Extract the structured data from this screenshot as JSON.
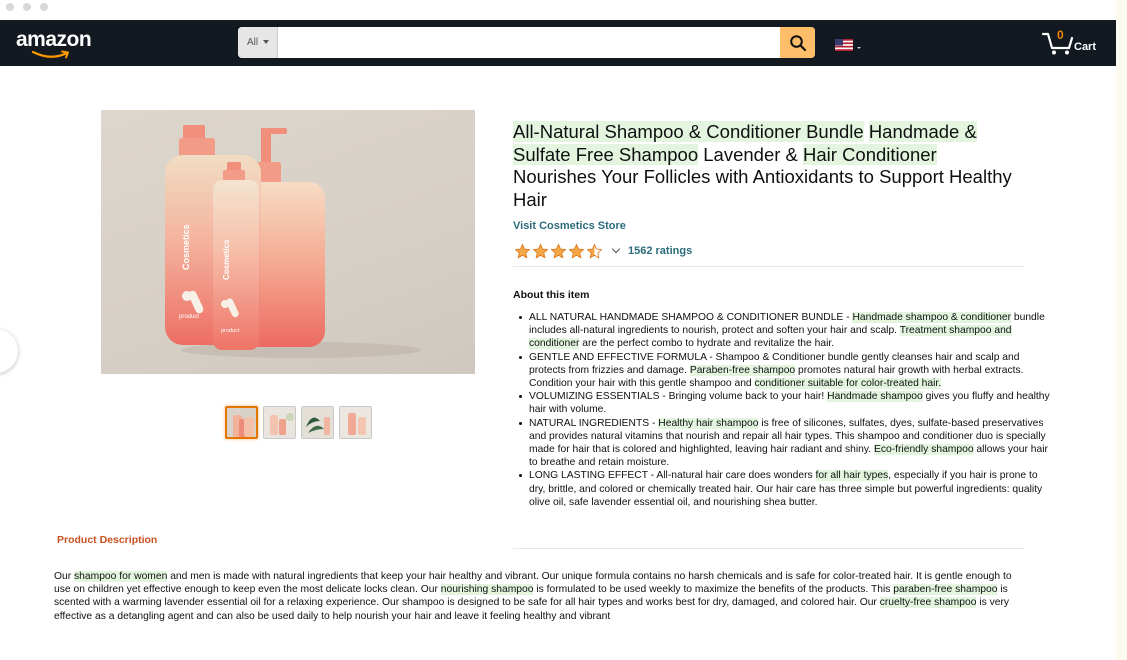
{
  "header": {
    "logo_text": "amazon",
    "search_category": "All",
    "search_placeholder": "",
    "cart_count": "0",
    "cart_label": "Cart"
  },
  "product": {
    "title_parts": [
      {
        "text": "All-Natural Shampoo & Conditioner Bundle",
        "highlight": true
      },
      {
        "text": " ",
        "highlight": false
      },
      {
        "text": "Handmade & Sulfate Free Shampoo",
        "highlight": true
      },
      {
        "text": " Lavender & ",
        "highlight": false
      },
      {
        "text": "Hair Conditioner",
        "highlight": true
      },
      {
        "text": " Nourishes Your Follicles with Antioxidants to Support Healthy Hair",
        "highlight": false
      }
    ],
    "store_link": "Visit Cosmetics Store",
    "rating_value": 4.5,
    "rating_count": "1562 ratings",
    "image_label_brand": "Cosmetics",
    "image_label_product": "product",
    "thumbnail_count": 4
  },
  "about": {
    "heading": "About this item",
    "bullets": [
      [
        {
          "text": "ALL NATURAL HANDMADE SHAMPOO & CONDITIONER BUNDLE - ",
          "highlight": false
        },
        {
          "text": "Handmade shampoo & conditioner",
          "highlight": true
        },
        {
          "text": " bundle includes all-natural ingredients to nourish, protect and soften your hair and scalp. ",
          "highlight": false
        },
        {
          "text": "Treatment shampoo and conditioner",
          "highlight": true
        },
        {
          "text": " are the perfect combo to hydrate and revitalize the hair.",
          "highlight": false
        }
      ],
      [
        {
          "text": "GENTLE AND EFFECTIVE FORMULA - Shampoo & Conditioner bundle gently cleanses hair and scalp and protects from frizzies and damage. ",
          "highlight": false
        },
        {
          "text": "Paraben-free shampoo",
          "highlight": true
        },
        {
          "text": " promotes natural hair growth with herbal extracts. Condition your hair with this gentle shampoo and ",
          "highlight": false
        },
        {
          "text": "conditioner suitable for color-treated hair.",
          "highlight": true
        }
      ],
      [
        {
          "text": "VOLUMIZING ESSENTIALS - Bringing volume back to your hair! ",
          "highlight": false
        },
        {
          "text": "Handmade shampoo",
          "highlight": true
        },
        {
          "text": " gives you fluffy and healthy hair with volume.",
          "highlight": false
        }
      ],
      [
        {
          "text": "NATURAL INGREDIENTS - ",
          "highlight": false
        },
        {
          "text": "Healthy hair shampoo",
          "highlight": true
        },
        {
          "text": " is free of silicones, sulfates, dyes, sulfate-based preservatives and provides natural vitamins that nourish and repair all hair types. This shampoo and conditioner duo is specially made for hair that is colored and highlighted, leaving hair radiant and shiny. ",
          "highlight": false
        },
        {
          "text": "Eco-friendly shampoo",
          "highlight": true
        },
        {
          "text": " allows your hair to breathe and retain moisture.",
          "highlight": false
        }
      ],
      [
        {
          "text": "LONG LASTING EFFECT - All-natural hair care does wonders ",
          "highlight": false
        },
        {
          "text": "for all hair types",
          "highlight": true
        },
        {
          "text": ", especially if you hair is prone to dry, brittle, and colored or chemically treated hair. Our hair care has three simple but powerful ingredients: quality olive oil, safe lavender essential oil, and nourishing shea butter.",
          "highlight": false
        }
      ]
    ]
  },
  "description": {
    "heading": "Product Description",
    "parts": [
      {
        "text": "Our ",
        "highlight": false
      },
      {
        "text": "shampoo for women",
        "highlight": true
      },
      {
        "text": " and men is made with natural ingredients that keep your hair healthy and vibrant. Our unique formula contains no harsh chemicals and is safe for color-treated hair. It is gentle enough to use on children yet effective enough to keep even the most delicate locks clean. Our ",
        "highlight": false
      },
      {
        "text": "nourishing shampoo",
        "highlight": true
      },
      {
        "text": " is formulated to be used weekly to maximize the benefits of the products. This ",
        "highlight": false
      },
      {
        "text": "paraben-free shampoo",
        "highlight": true
      },
      {
        "text": " is scented with a warming lavender essential oil for a relaxing experience. Our shampoo is designed to be safe for all hair types and works best for dry, damaged, and colored hair. Our ",
        "highlight": false
      },
      {
        "text": "cruelty-free shampoo",
        "highlight": true
      },
      {
        "text": " is very effective as a detangling agent and can also be used daily to help nourish your hair and leave it feeling healthy and vibrant",
        "highlight": false
      }
    ]
  },
  "colors": {
    "nav_bg": "#131921",
    "search_button": "#febd69",
    "highlight": "#e3f5df",
    "link": "#2c6c7b",
    "star": "#f3a847",
    "description_heading": "#c7511f"
  }
}
